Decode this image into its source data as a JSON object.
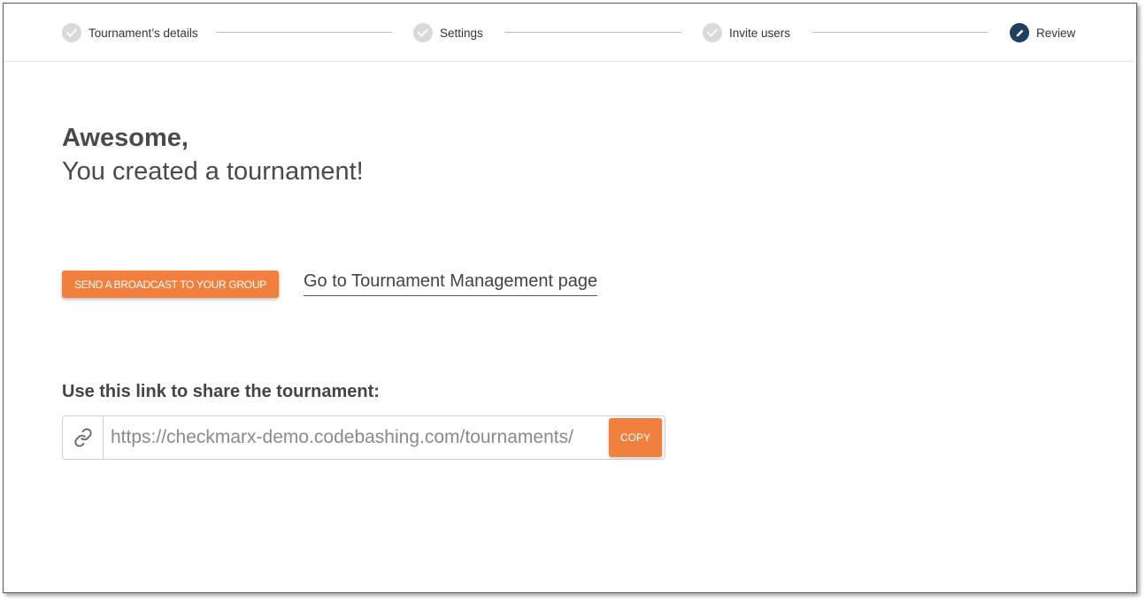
{
  "stepper": {
    "steps": [
      {
        "label": "Tournament’s details",
        "state": "completed",
        "icon": "check-icon"
      },
      {
        "label": "Settings",
        "state": "completed",
        "icon": "check-icon"
      },
      {
        "label": "Invite users",
        "state": "completed",
        "icon": "check-icon"
      },
      {
        "label": "Review",
        "state": "active",
        "icon": "pencil-icon"
      }
    ]
  },
  "heading": {
    "line1": "Awesome,",
    "line2": "You created a tournament!"
  },
  "actions": {
    "broadcast_label": "SEND A BROADCAST TO YOUR GROUP",
    "management_link": "Go to Tournament Management page"
  },
  "share": {
    "label": "Use this link to share the tournament:",
    "url": "https://checkmarx-demo.codebashing.com/tournaments/",
    "copy_label": "COPY",
    "icon": "link-icon"
  },
  "colors": {
    "accent": "#f1803f",
    "active_step": "#21405f",
    "completed_step": "#d9d9d9"
  }
}
